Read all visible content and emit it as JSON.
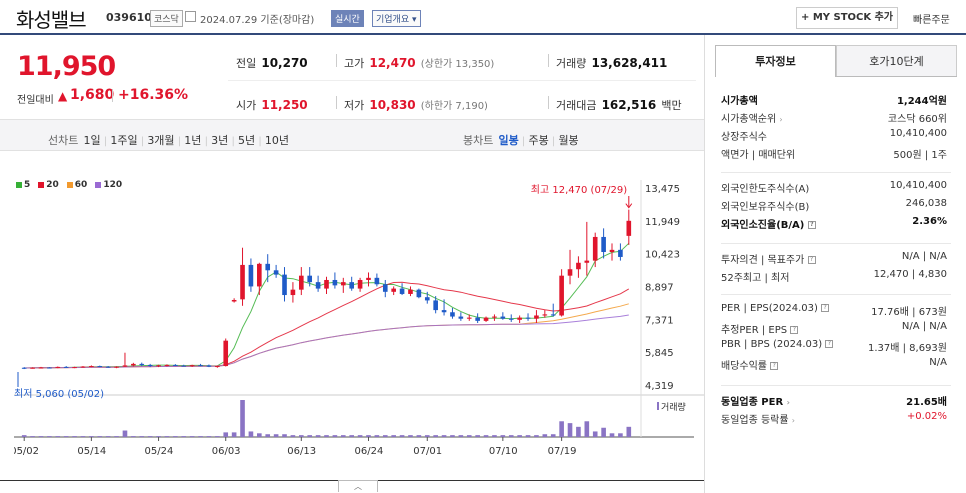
{
  "header": {
    "name": "화성밸브",
    "code": "039610",
    "market": "코스닥",
    "date": "2024.07.29 기준(장마감)",
    "live": "실시간",
    "overview": "기업개요",
    "mystock": "+ MY STOCK 추가",
    "quick_order": "빠른주문"
  },
  "price": {
    "current": "11,950",
    "change_label": "전일대비",
    "change_arrow": "▲",
    "change_value": "1,680",
    "change_rate": "+16.36%"
  },
  "quote": {
    "prev_label": "전일",
    "prev": "10,270",
    "high_label": "고가",
    "high": "12,470",
    "high_limit": "(상한가 13,350)",
    "volume_label": "거래량",
    "volume": "13,628,411",
    "open_label": "시가",
    "open": "11,250",
    "low_label": "저가",
    "low": "10,830",
    "low_limit": "(하한가 7,190)",
    "amount_label": "거래대금",
    "amount": "162,516",
    "amount_unit": "백만"
  },
  "periods": {
    "line_label": "선차트",
    "line_items": [
      "1일",
      "1주일",
      "3개월",
      "1년",
      "3년",
      "5년",
      "10년"
    ],
    "candle_label": "봉차트",
    "candle_items": [
      "일봉",
      "주봉",
      "월봉"
    ],
    "active": "일봉"
  },
  "legend": [
    {
      "label": "5",
      "color": "#36b036"
    },
    {
      "label": "20",
      "color": "#e0152c"
    },
    {
      "label": "60",
      "color": "#f29a2e"
    },
    {
      "label": "120",
      "color": "#9a6ad3"
    }
  ],
  "chart_data": {
    "type": "candlestick",
    "y_ticks": [
      "13,475",
      "11,949",
      "10,423",
      "8,897",
      "7,371",
      "5,845",
      "4,319"
    ],
    "ylim": [
      4319,
      13475
    ],
    "x_ticks": [
      "05/02",
      "05/14",
      "05/24",
      "06/03",
      "06/13",
      "06/24",
      "07/01",
      "07/10",
      "07/19"
    ],
    "high_annotation": "최고 12,470 (07/29)",
    "low_annotation": "최저 5,060 (05/02)",
    "volume_label": "거래량",
    "candles": [
      [
        5120,
        5150,
        5060,
        5110
      ],
      [
        5110,
        5140,
        5080,
        5120
      ],
      [
        5120,
        5160,
        5090,
        5130
      ],
      [
        5130,
        5150,
        5100,
        5120
      ],
      [
        5120,
        5180,
        5100,
        5160
      ],
      [
        5160,
        5200,
        5120,
        5140
      ],
      [
        5140,
        5170,
        5100,
        5150
      ],
      [
        5150,
        5200,
        5120,
        5180
      ],
      [
        5180,
        5230,
        5150,
        5200
      ],
      [
        5200,
        5220,
        5150,
        5170
      ],
      [
        5170,
        5200,
        5120,
        5150
      ],
      [
        5150,
        5190,
        5100,
        5170
      ],
      [
        5170,
        5820,
        5150,
        5230
      ],
      [
        5230,
        5350,
        5180,
        5300
      ],
      [
        5300,
        5360,
        5200,
        5250
      ],
      [
        5250,
        5300,
        5150,
        5200
      ],
      [
        5200,
        5260,
        5150,
        5230
      ],
      [
        5230,
        5280,
        5180,
        5250
      ],
      [
        5250,
        5290,
        5200,
        5220
      ],
      [
        5220,
        5260,
        5180,
        5200
      ],
      [
        5200,
        5260,
        5160,
        5240
      ],
      [
        5240,
        5300,
        5200,
        5230
      ],
      [
        5230,
        5270,
        5150,
        5170
      ],
      [
        5170,
        5220,
        5120,
        5200
      ],
      [
        5200,
        6480,
        5180,
        6380
      ],
      [
        8200,
        8350,
        8150,
        8270
      ],
      [
        8300,
        10700,
        8000,
        9900
      ],
      [
        9900,
        10200,
        8650,
        8900
      ],
      [
        8900,
        10000,
        8500,
        9950
      ],
      [
        9950,
        10400,
        9100,
        9650
      ],
      [
        9650,
        9900,
        9300,
        9450
      ],
      [
        9450,
        9800,
        8200,
        8500
      ],
      [
        8500,
        9100,
        8150,
        8750
      ],
      [
        8750,
        9800,
        8500,
        9400
      ],
      [
        9400,
        9800,
        8900,
        9100
      ],
      [
        9100,
        9400,
        8650,
        8800
      ],
      [
        8800,
        9350,
        8550,
        9200
      ],
      [
        9200,
        9550,
        8800,
        8950
      ],
      [
        8950,
        9300,
        8600,
        9100
      ],
      [
        9100,
        9350,
        8700,
        8800
      ],
      [
        8800,
        9300,
        8650,
        9200
      ],
      [
        9200,
        9550,
        8900,
        9300
      ],
      [
        9300,
        9500,
        8900,
        9000
      ],
      [
        9000,
        9200,
        8400,
        8650
      ],
      [
        8650,
        8900,
        8500,
        8800
      ],
      [
        8800,
        9050,
        8500,
        8550
      ],
      [
        8550,
        8900,
        8450,
        8750
      ],
      [
        8750,
        8800,
        8350,
        8400
      ],
      [
        8400,
        8650,
        8100,
        8250
      ],
      [
        8250,
        8450,
        7650,
        7800
      ],
      [
        7800,
        8300,
        7550,
        7700
      ],
      [
        7700,
        7900,
        7400,
        7500
      ],
      [
        7500,
        7700,
        7300,
        7400
      ],
      [
        7400,
        7600,
        7300,
        7450
      ],
      [
        7450,
        7650,
        7200,
        7300
      ],
      [
        7300,
        7500,
        7250,
        7450
      ],
      [
        7450,
        7600,
        7300,
        7500
      ],
      [
        7500,
        7700,
        7350,
        7400
      ],
      [
        7400,
        7600,
        7250,
        7350
      ],
      [
        7350,
        7550,
        7200,
        7450
      ],
      [
        7450,
        7650,
        7300,
        7400
      ],
      [
        7400,
        7800,
        7200,
        7550
      ],
      [
        7550,
        7800,
        7450,
        7600
      ],
      [
        7600,
        8100,
        7500,
        7550
      ],
      [
        7550,
        9700,
        7500,
        9400
      ],
      [
        9400,
        10600,
        9000,
        9700
      ],
      [
        9700,
        10300,
        9300,
        10000
      ],
      [
        10000,
        11900,
        9400,
        10100
      ],
      [
        10100,
        11400,
        9800,
        11200
      ],
      [
        11200,
        11600,
        10200,
        10500
      ],
      [
        10500,
        10900,
        10100,
        10600
      ],
      [
        10600,
        10900,
        10100,
        10270
      ],
      [
        11250,
        12470,
        10830,
        11950
      ]
    ],
    "volumes": [
      2,
      1,
      1,
      1,
      1,
      1,
      1,
      1,
      1,
      1,
      1,
      1,
      7,
      1,
      1,
      1,
      1,
      1,
      1,
      1,
      1,
      1,
      1,
      1,
      5,
      5,
      40,
      6,
      4,
      3,
      3,
      3,
      2,
      2,
      2,
      2,
      2,
      2,
      2,
      2,
      2,
      2,
      2,
      2,
      2,
      2,
      2,
      2,
      2,
      2,
      2,
      2,
      2,
      2,
      2,
      2,
      2,
      2,
      2,
      2,
      2,
      2,
      3,
      3,
      17,
      15,
      11,
      17,
      6,
      10,
      4,
      4,
      11
    ]
  },
  "right_panel": {
    "tab_invest": "투자정보",
    "tab_quote": "호가10단계",
    "rows_1": [
      {
        "label": "시가총액",
        "value": "1,244억원",
        "bold": true
      },
      {
        "label": "시가총액순위",
        "value": "코스닥 660위"
      },
      {
        "label": "상장주식수",
        "value": "10,410,400"
      },
      {
        "label": "액면가 | 매매단위",
        "value": "500원 | 1주"
      }
    ],
    "rows_2": [
      {
        "label": "외국인한도주식수(A)",
        "value": "10,410,400"
      },
      {
        "label": "외국인보유주식수(B)",
        "value": "246,038"
      },
      {
        "label": "외국인소진율(B/A)",
        "value": "2.36%",
        "bold": true
      }
    ],
    "rows_3": [
      {
        "label": "투자의견 | 목표주가",
        "value": "N/A | N/A"
      },
      {
        "label": "52주최고 | 최저",
        "value": "12,470 | 4,830"
      }
    ],
    "rows_4": [
      {
        "label": "PER | EPS(2024.03)",
        "value": "17.76배 | 673원"
      },
      {
        "label": "추정PER | EPS",
        "value": "N/A | N/A"
      },
      {
        "label": "PBR | BPS (2024.03)",
        "value": "1.37배 | 8,693원"
      },
      {
        "label": "배당수익률",
        "value": "N/A"
      }
    ],
    "rows_5": [
      {
        "label": "동일업종 PER",
        "value": "21.65배",
        "bold": true
      },
      {
        "label": "동일업종 등락률",
        "value": "+0.02%",
        "red": true
      }
    ]
  }
}
